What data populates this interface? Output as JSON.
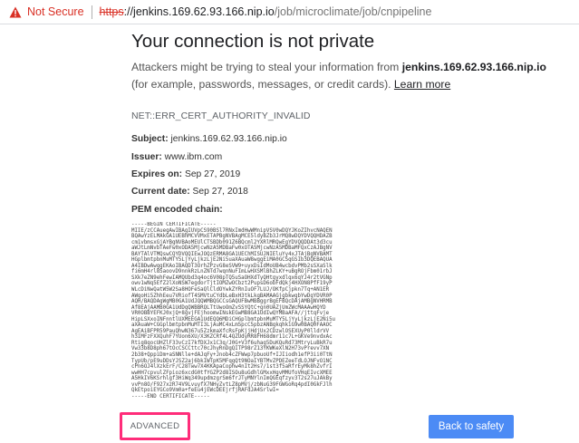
{
  "address_bar": {
    "security_label": "Not Secure",
    "protocol": "https",
    "host": "://jenkins.169.62.93.166.nip.io",
    "path": "/job/microclimate/job/cnpipeline",
    "warning_color": "#d93025"
  },
  "page": {
    "title": "Your connection is not private",
    "desc_prefix": "Attackers might be trying to steal your information from ",
    "desc_host": "jenkins.169.62.93.166.nip.io",
    "desc_suffix": " (for example, passwords, messages, or credit cards). ",
    "learn_more": "Learn more",
    "error_code": "NET::ERR_CERT_AUTHORITY_INVALID"
  },
  "certificate": {
    "subject_label": "Subject:",
    "subject_value": "jenkins.169.62.93.166.nip.io",
    "issuer_label": "Issuer:",
    "issuer_value": "www.ibm.com",
    "expires_label": "Expires on:",
    "expires_value": "Sep 27, 2019",
    "current_label": "Current date:",
    "current_value": "Sep 27, 2018",
    "pem_label": "PEM encoded chain:",
    "pem_text": "-----BEGIN CERTIFICATE-----\nMIIE/zCCAuegAwIBAgIUVpCS90BSl7RNxImdHwWMnipVSV0wDQYJKoZIhvcNAQEN\nBQAwYzELMAkGA1UEBhMCVVMxETAPBgNVBAgMCE5ldyBZb3JrMQ8wDQYDVQQHDAZB\ncm1vbmsxGjAYBgNVBAoMEUlCTSBDb091Z6BQcml2YXRlMRQwEgYDVQQDDAt3d3cu\naWJtLmNvbTAeFw0xODA5MjcwNzA5MDBaFw0xOTA5MjcwNzA5MDBaMFQxCzAJBgNV\nBAYTAlVTMQswCQYDVQQIEwJOQzERMA8GA1UEChMISUJNIEluYy4xJTAjBgNVBAMT\nHGplbmtpbnMuMTY5LjYyLjkzLjE2Ni5uaXAuaW8wggEiMA0GCSqGSIb3DQEBAQUA\nA4IBDwAwggEKAoIBAQDT3OrhZPzvG8eSVW9+uyxDsIdMoUB4wcbdvPMb2sSXaSlk\nfi6mH4rl8SaoovD9nnkRzLnZNTd7wqnNuFImLwHXSMlBhZLKY+uBgROjFbm01rbJ\nSXk7eZN9ehFewIAMQUbd3q4oc6V08pTQ5uSaOHXdTyQHtgyxdlqx6qYJ4r2tVGNp\nowv1wNq5EfZ2lXoNSW7egdorTjtIOMZwOCbzt2PupsD6obFdQkj4HXON8PfF19yP\nWLcDiNwQatW5W2Sa8HOFeSaQlCldOYwkZYRnIuOF7LUJ/OKfpCjpkn7Tq+AN1ER\nAWgoHi5ZhhEeu7VRiofT4SMVtuCYdbLeBxH3tkLkgBAMAAGjgbkwgbYwDgYDVR0P\nAQH/BAQDAgWgMB0GA1UdJQQWMBQGCCsGAQUFBwMBBggrBgEFBQcDAjAMBgNVHRMB\nAf8EAjAAMB0GA1UdDgQWBBRQLTtUwoOmZvSSYQtC+gn0UAZjUmZWcMAAAwHQYD\nVR0OBBYEFKJ0xjQ+8gvjFEjhoomwINskEGwMB8GA1UdIwQYMBaAFA//jttqFvje\nHipLSXxoINFnntlUXMEEGA1UdEQQ6MDiCHGplbmtpbnMuMTY5LjYyLjkzLjE2Ni5u\naXAuaW+CGGplbmtpbnMuMTI3LjAuMC4xLm5pcC5pbzANBgkqhkiG9w0BAQ0FAAOC\nAgEAiBFPR59PauQhwN367u5ZzkmaXfcRsFpKjjHdjUx2CDzwlOSEXUyP0lldrVV\nh3IMFzFXXQuhF7YUon6XU/X3KZCRf4L4QZUdyRR8FH68dmr11c7L+GKVe9nvdxAc\nRtig8qocUHZlF33vCzI7kfDXJx1C3q/J0G+V3f6uhag5DuKQuRd73MtryLuBkR7u\nVw33b8D8ph67tOcCSCCttc70cJhyRnDgQITP98rZ13YKWKeXlN2H73vPrevv7XN\n2b38+QppiDm+aSNNlle+dAJqFy+Jnob4cZFWwp7pbuoUf+IJIiodh1efP3ii0TtN\nTypUb/pE9uDDsYJSZ2aj6bkIWTpK5MFqgQt9NOaIYBTMvZPDEZeeTdLOJNFvO1NC\ncPn6OJ4lXzkErF/C28Tww7X4KKApaCophw4nIt2Hs7/1st3f5aRfrEyMk8hZvfrI\nwwHH7cpvulZFpioz6xcdG0tfYGZP2d8ISOu8uGdhlGMxxHgvMMUfoVHqEIvcXMEE\nA5HkIV6KSrhlgf3HiWq349updmzgrSm6frJTyMNYlnImQGEqfzyv3T2s27uJAkBy\nvvPn8O/F927xzR74V9LvuyfX7NHyZvtLZ8pMVj/zbNuG39FGWGoRq4pdI0GkFJlh\nQkEtpoiEYGCo9Vm0a+feEu4jEWcDEEjrfjRAFdJA4SrlwI=\n-----END CERTIFICATE-----"
  },
  "buttons": {
    "advanced": "ADVANCED",
    "back": "Back to safety",
    "primary_color": "#4c8bf5",
    "highlight_color": "#ff2d7a"
  }
}
